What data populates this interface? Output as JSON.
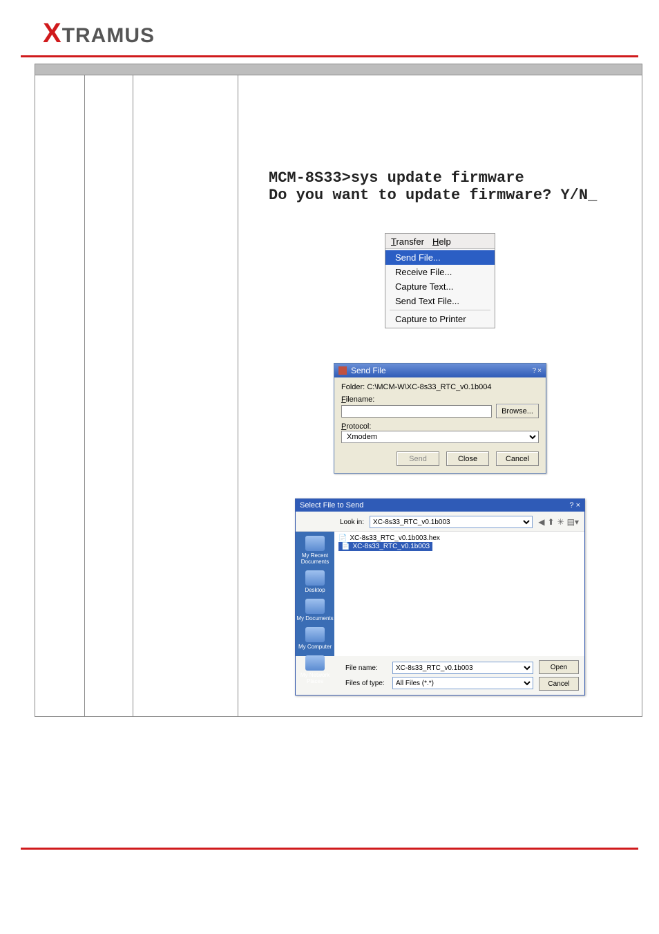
{
  "logo": {
    "x": "X",
    "rest": "TRAMUS"
  },
  "terminal": {
    "line1": "MCM-8S33>sys update firmware",
    "line2": "Do you want to update firmware? Y/N_"
  },
  "transfer_menu": {
    "bar_transfer": "Transfer",
    "bar_help": "Help",
    "items": [
      "Send File...",
      "Receive File...",
      "Capture Text...",
      "Send Text File...",
      "Capture to Printer"
    ]
  },
  "sendfile_dialog": {
    "title": "Send File",
    "help_icon": "?",
    "close_icon": "×",
    "folder_label": "Folder:",
    "folder_value": "C:\\MCM-W\\XC-8s33_RTC_v0.1b004",
    "filename_label": "Filename:",
    "filename_value": "",
    "browse_btn": "Browse...",
    "protocol_label": "Protocol:",
    "protocol_value": "Xmodem",
    "send_btn": "Send",
    "close_btn": "Close",
    "cancel_btn": "Cancel"
  },
  "file_dialog": {
    "title": "Select File to Send",
    "help_icon": "?",
    "close_icon": "×",
    "lookin_label": "Look in:",
    "lookin_value": "XC-8s33_RTC_v0.1b003",
    "sidebar": [
      "My Recent Documents",
      "Desktop",
      "My Documents",
      "My Computer",
      "My Network Places"
    ],
    "files": [
      "XC-8s33_RTC_v0.1b003.hex",
      "XC-8s33_RTC_v0.1b003"
    ],
    "filename_label": "File name:",
    "filename_value": "XC-8s33_RTC_v0.1b003",
    "filetype_label": "Files of type:",
    "filetype_value": "All Files (*.*)",
    "open_btn": "Open",
    "cancel_btn": "Cancel"
  }
}
